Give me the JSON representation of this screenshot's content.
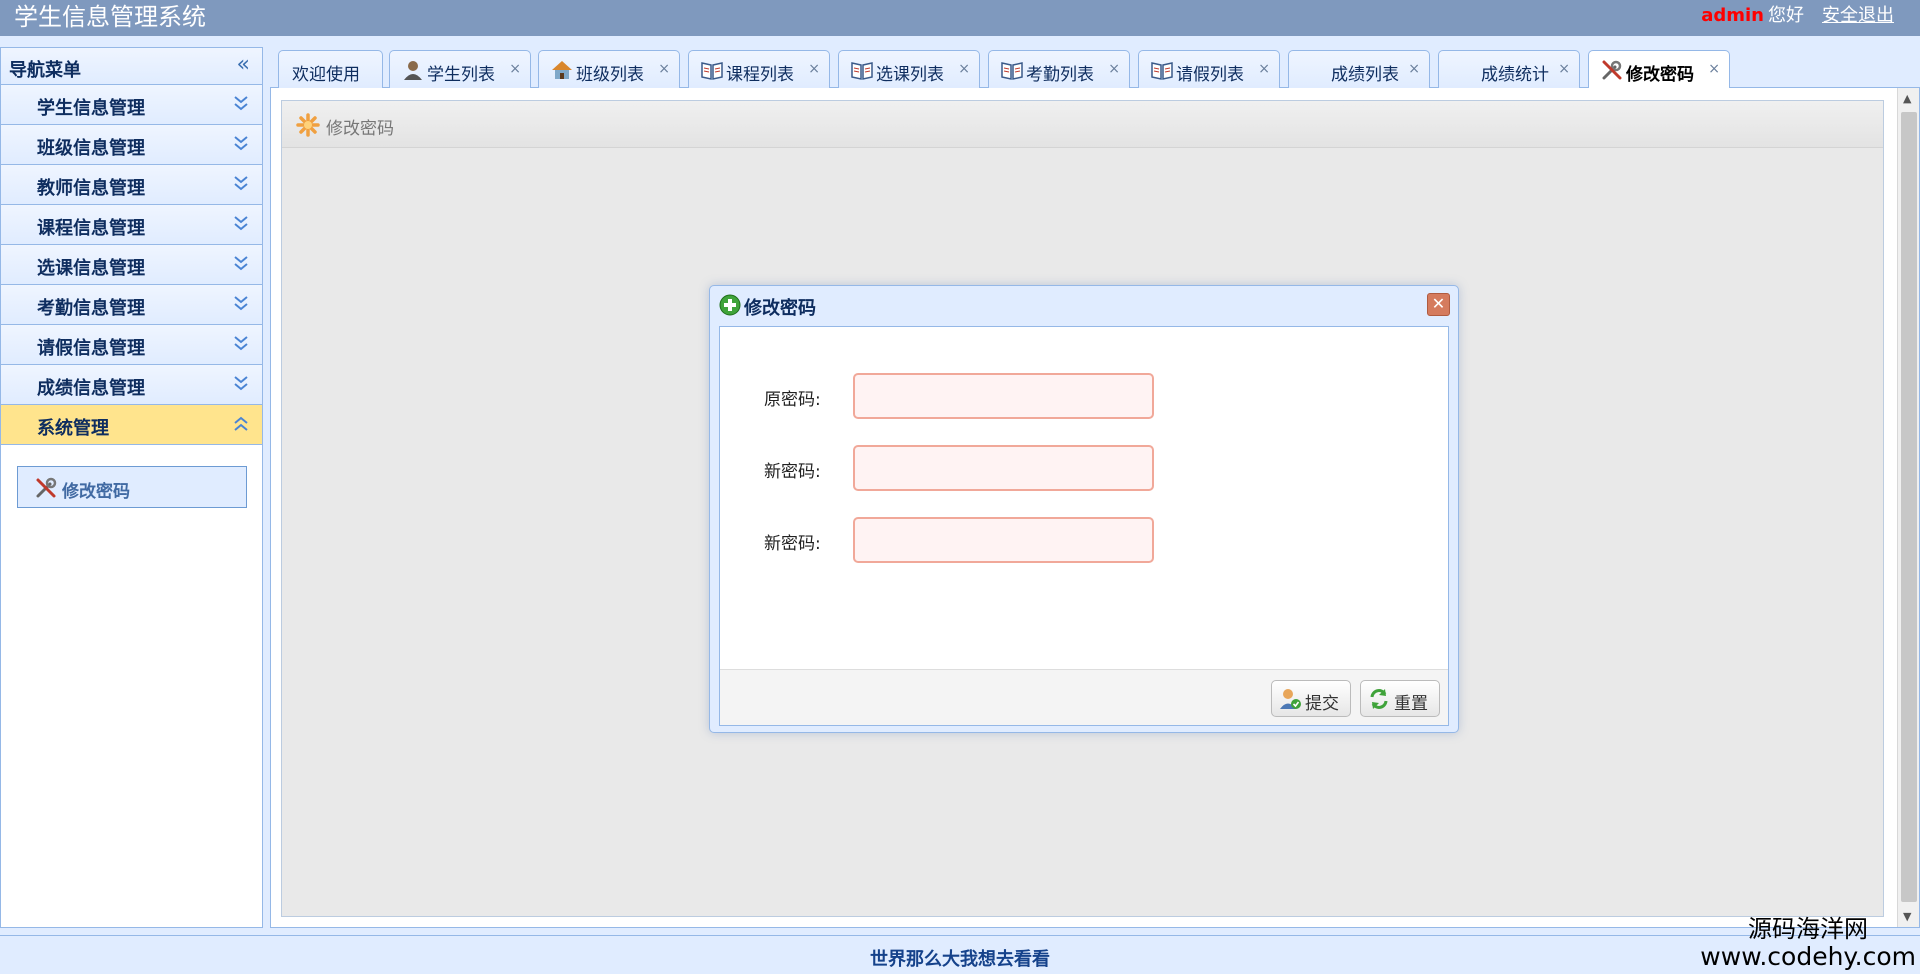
{
  "header": {
    "title": "学生信息管理系统",
    "username": "admin",
    "greeting": "您好",
    "logout": "安全退出"
  },
  "nav": {
    "title": "导航菜单",
    "collapse_icon": "double-chevron-left-icon",
    "items": [
      {
        "label": "学生信息管理"
      },
      {
        "label": "班级信息管理"
      },
      {
        "label": "教师信息管理"
      },
      {
        "label": "课程信息管理"
      },
      {
        "label": "选课信息管理"
      },
      {
        "label": "考勤信息管理"
      },
      {
        "label": "请假信息管理"
      },
      {
        "label": "成绩信息管理"
      },
      {
        "label": "系统管理"
      }
    ],
    "active_item": "系统管理",
    "sub_items": [
      {
        "label": "修改密码",
        "icon": "tools-icon"
      }
    ]
  },
  "tabs": [
    {
      "label": "欢迎使用",
      "closable": false
    },
    {
      "label": "学生列表",
      "icon": "user-icon",
      "closable": true
    },
    {
      "label": "班级列表",
      "icon": "house-icon",
      "closable": true
    },
    {
      "label": "课程列表",
      "icon": "book-icon",
      "closable": true
    },
    {
      "label": "选课列表",
      "icon": "book-icon",
      "closable": true
    },
    {
      "label": "考勤列表",
      "icon": "book-icon",
      "closable": true
    },
    {
      "label": "请假列表",
      "icon": "book-icon",
      "closable": true
    },
    {
      "label": "成绩列表",
      "closable": true
    },
    {
      "label": "成绩统计",
      "closable": true
    },
    {
      "label": "修改密码",
      "icon": "tools-icon",
      "closable": true,
      "active": true
    }
  ],
  "close_symbol": "×",
  "panel": {
    "title": "修改密码",
    "icon": "gear-icon"
  },
  "dialog": {
    "title": "修改密码",
    "icon": "add-icon",
    "close_symbol": "✕",
    "fields": [
      {
        "label": "原密码:",
        "value": ""
      },
      {
        "label": "新密码:",
        "value": ""
      },
      {
        "label": "新密码:",
        "value": ""
      }
    ],
    "submit_label": "提交",
    "reset_label": "重置"
  },
  "footer": {
    "text": "世界那么大我想去看看"
  },
  "watermark": {
    "line1": "源码海洋网",
    "line2": "www.codehy.com"
  },
  "colors": {
    "header_bg": "#7F99BE",
    "accent": "#95B8E7",
    "active_nav": "#FFE48D",
    "username": "#FF0000",
    "input_border": "#F1A899",
    "input_bg": "#FFF3F3"
  }
}
